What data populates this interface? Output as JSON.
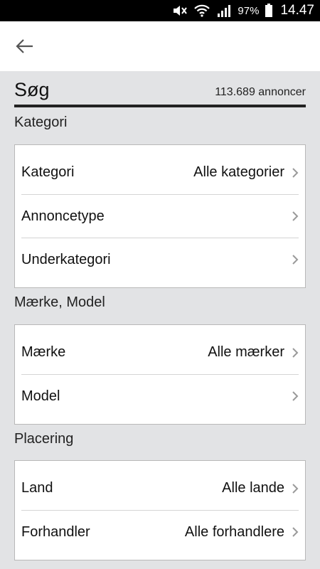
{
  "status_bar": {
    "icons": [
      "mute-icon",
      "wifi-icon",
      "signal-icon",
      "battery-icon"
    ],
    "battery_percent": "97%",
    "time": "14.47"
  },
  "app_bar": {
    "back_icon": "arrow-left-icon"
  },
  "search": {
    "title": "Søg",
    "ad_count": "113.689 annoncer"
  },
  "sections": {
    "category": {
      "heading": "Kategori",
      "rows": [
        {
          "label": "Kategori",
          "value": "Alle kategorier"
        },
        {
          "label": "Annoncetype",
          "value": ""
        },
        {
          "label": "Underkategori",
          "value": ""
        }
      ]
    },
    "make_model": {
      "heading": "Mærke, Model",
      "rows": [
        {
          "label": "Mærke",
          "value": "Alle mærker"
        },
        {
          "label": "Model",
          "value": ""
        }
      ]
    },
    "location": {
      "heading": "Placering",
      "rows": [
        {
          "label": "Land",
          "value": "Alle lande"
        },
        {
          "label": "Forhandler",
          "value": "Alle forhandlere"
        }
      ]
    }
  },
  "colors": {
    "background": "#e2e3e5",
    "card": "#ffffff",
    "status_bar": "#000000",
    "text": "#111111"
  }
}
